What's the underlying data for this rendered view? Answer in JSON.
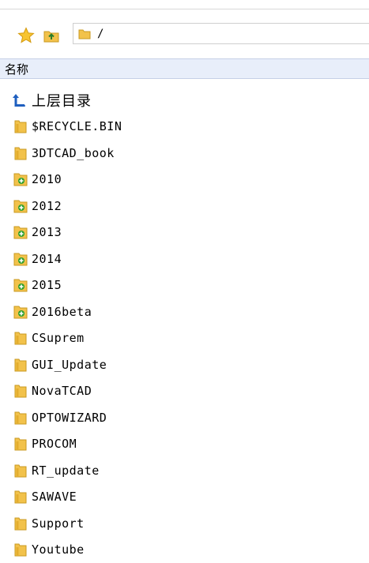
{
  "toolbar": {
    "favorite_icon": "star-icon",
    "up_icon": "folder-up-icon",
    "path_icon": "folder-icon",
    "path": "/"
  },
  "header": {
    "name_column": "名称"
  },
  "items": [
    {
      "label": "上层目录",
      "kind": "up",
      "icon": "up-arrow-icon"
    },
    {
      "label": "$RECYCLE.BIN",
      "kind": "folder",
      "icon": "folder-icon"
    },
    {
      "label": "3DTCAD_book",
      "kind": "folder",
      "icon": "folder-icon"
    },
    {
      "label": "2010",
      "kind": "folder-plus",
      "icon": "folder-plus-icon"
    },
    {
      "label": "2012",
      "kind": "folder-plus",
      "icon": "folder-plus-icon"
    },
    {
      "label": "2013",
      "kind": "folder-plus",
      "icon": "folder-plus-icon"
    },
    {
      "label": "2014",
      "kind": "folder-plus",
      "icon": "folder-plus-icon"
    },
    {
      "label": "2015",
      "kind": "folder-plus",
      "icon": "folder-plus-icon"
    },
    {
      "label": "2016beta",
      "kind": "folder-plus",
      "icon": "folder-plus-icon"
    },
    {
      "label": "CSuprem",
      "kind": "folder",
      "icon": "folder-icon"
    },
    {
      "label": "GUI_Update",
      "kind": "folder",
      "icon": "folder-icon"
    },
    {
      "label": "NovaTCAD",
      "kind": "folder",
      "icon": "folder-icon"
    },
    {
      "label": "OPTOWIZARD",
      "kind": "folder",
      "icon": "folder-icon"
    },
    {
      "label": "PROCOM",
      "kind": "folder",
      "icon": "folder-icon"
    },
    {
      "label": "RT_update",
      "kind": "folder",
      "icon": "folder-icon"
    },
    {
      "label": "SAWAVE",
      "kind": "folder",
      "icon": "folder-icon"
    },
    {
      "label": "Support",
      "kind": "folder",
      "icon": "folder-icon"
    },
    {
      "label": "Youtube",
      "kind": "folder",
      "icon": "folder-icon"
    }
  ],
  "colors": {
    "header_bg": "#e8eefa",
    "folder": "#f2c24b",
    "plus": "#2ea02e",
    "up_arrow": "#1f5fbf"
  }
}
